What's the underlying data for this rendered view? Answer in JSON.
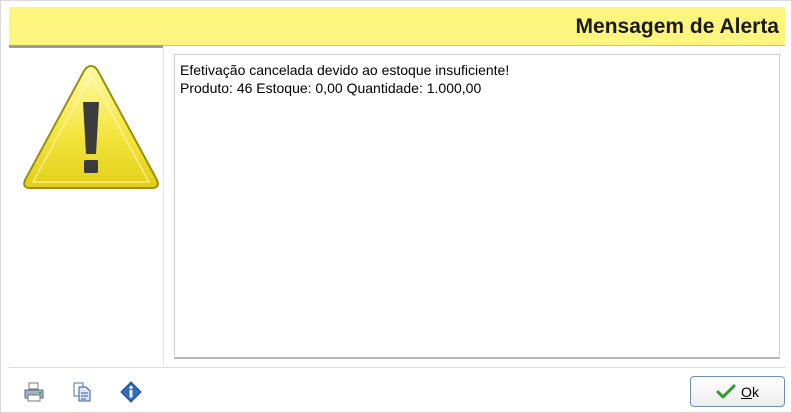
{
  "dialog": {
    "title": "Mensagem de Alerta",
    "icon": "warning-icon",
    "accent_color": "#fdf57e"
  },
  "message": {
    "lines": [
      "Efetivação cancelada devido ao estoque insuficiente!",
      "Produto: 46 Estoque: 0,00 Quantidade: 1.000,00"
    ]
  },
  "toolbar": {
    "icons": [
      "print-icon",
      "copy-icon",
      "info-icon"
    ]
  },
  "buttons": {
    "ok": {
      "mnemonic": "O",
      "rest": "k",
      "icon": "checkmark-icon"
    }
  }
}
